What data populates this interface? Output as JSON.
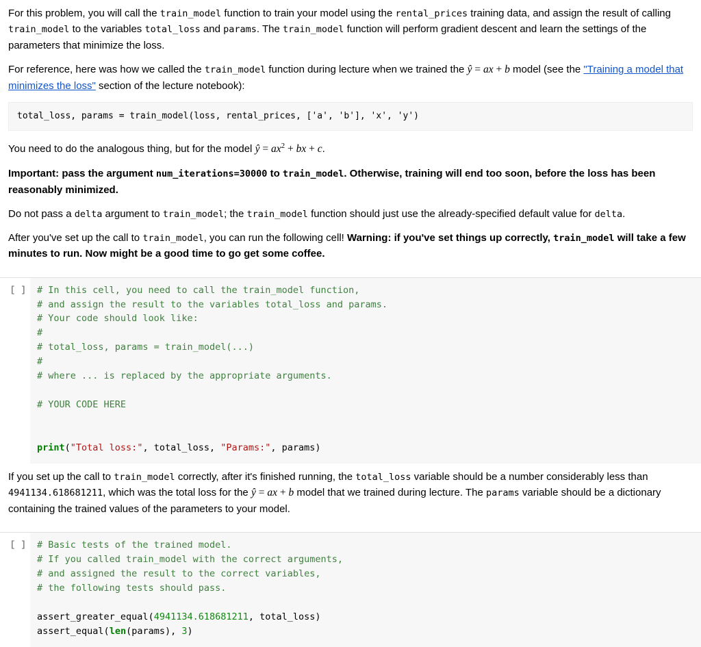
{
  "text1_before": "For this problem, you will call the ",
  "fn_train_model": "train_model",
  "text1_mid1": " function to train your model using the ",
  "data_rental": "rental_prices",
  "text1_mid2": " training data, and assign the result of calling ",
  "text1_mid3": " to the variables ",
  "var_total_loss": "total_loss",
  "text1_and": " and ",
  "var_params": "params",
  "text1_mid4": ". The ",
  "text1_end": " function will perform gradient descent and learn the settings of the parameters that minimize the loss.",
  "text2_before": "For reference, here was how we called the ",
  "text2_mid": " function during lecture when we trained the ",
  "eq_linear": "ŷ = ax + b",
  "text2_after_eq": " model (see the ",
  "link_text": "\"Training a model that minimizes the loss\"",
  "text2_end": " section of the lecture notebook):",
  "codeblock_sample": "total_loss, params = train_model(loss, rental_prices, ['a', 'b'], 'x', 'y')",
  "text3_before": "You need to do the analogous thing, but for the model ",
  "eq_quadratic": "ŷ = ax² + bx + c",
  "text3_end": ".",
  "text4_bold1": "Important: pass the argument ",
  "arg_numiter": "num_iterations=30000",
  "text4_bold2": " to ",
  "text4_bold3": ". Otherwise, training will end too soon, before the loss has been reasonably minimized.",
  "text5_before": "Do not pass a ",
  "arg_delta": "delta",
  "text5_mid1": " argument to ",
  "text5_mid2": "; the ",
  "text5_end": " function should just use the already-specified default value for ",
  "text6_before": "After you've set up the call to ",
  "text6_mid": ", you can run the following cell! ",
  "text6_bold1": "Warning: if you've set things up correctly, ",
  "text6_bold2": " will take a few minutes to run. Now might be a good time to go get some coffee.",
  "prompt_in": "[ ]",
  "cell1": {
    "l1": "# In this cell, you need to call the train_model function,",
    "l2": "# and assign the result to the variables total_loss and params.",
    "l3": "# Your code should look like:",
    "l4": "#",
    "l5": "# total_loss, params = train_model(...)",
    "l6": "#",
    "l7": "# where ... is replaced by the appropriate arguments.",
    "l8": "",
    "l9": "# YOUR CODE HERE",
    "p_name": "print",
    "p_open": "(",
    "p_s1": "\"Total loss:\"",
    "p_sep": ", total_loss, ",
    "p_s2": "\"Params:\"",
    "p_end": ", params)"
  },
  "text7_before": "If you set up the call to ",
  "text7_mid1": " correctly, after it's finished running, the ",
  "text7_mid2": " variable should be a number considerably less than ",
  "num_loss_ref": "4941134.618681211",
  "text7_mid3": ", which was the total loss for the ",
  "text7_mid4": " model that we trained during lecture. The ",
  "text7_end": " variable should be a dictionary containing the trained values of the parameters to your model.",
  "cell2": {
    "l1": "# Basic tests of the trained model.",
    "l2": "# If you called train_model with the correct arguments,",
    "l3": "# and assigned the result to the correct variables,",
    "l4": "# the following tests should pass.",
    "a1_fn": "assert_greater_equal",
    "a1_args_open": "(",
    "a1_num": "4941134.618681211",
    "a1_args_close": ", total_loss)",
    "a2_fn": "assert_equal",
    "a2_args_open": "(",
    "a2_len": "len",
    "a2_mid": "(params), ",
    "a2_num": "3",
    "a2_close": ")"
  }
}
